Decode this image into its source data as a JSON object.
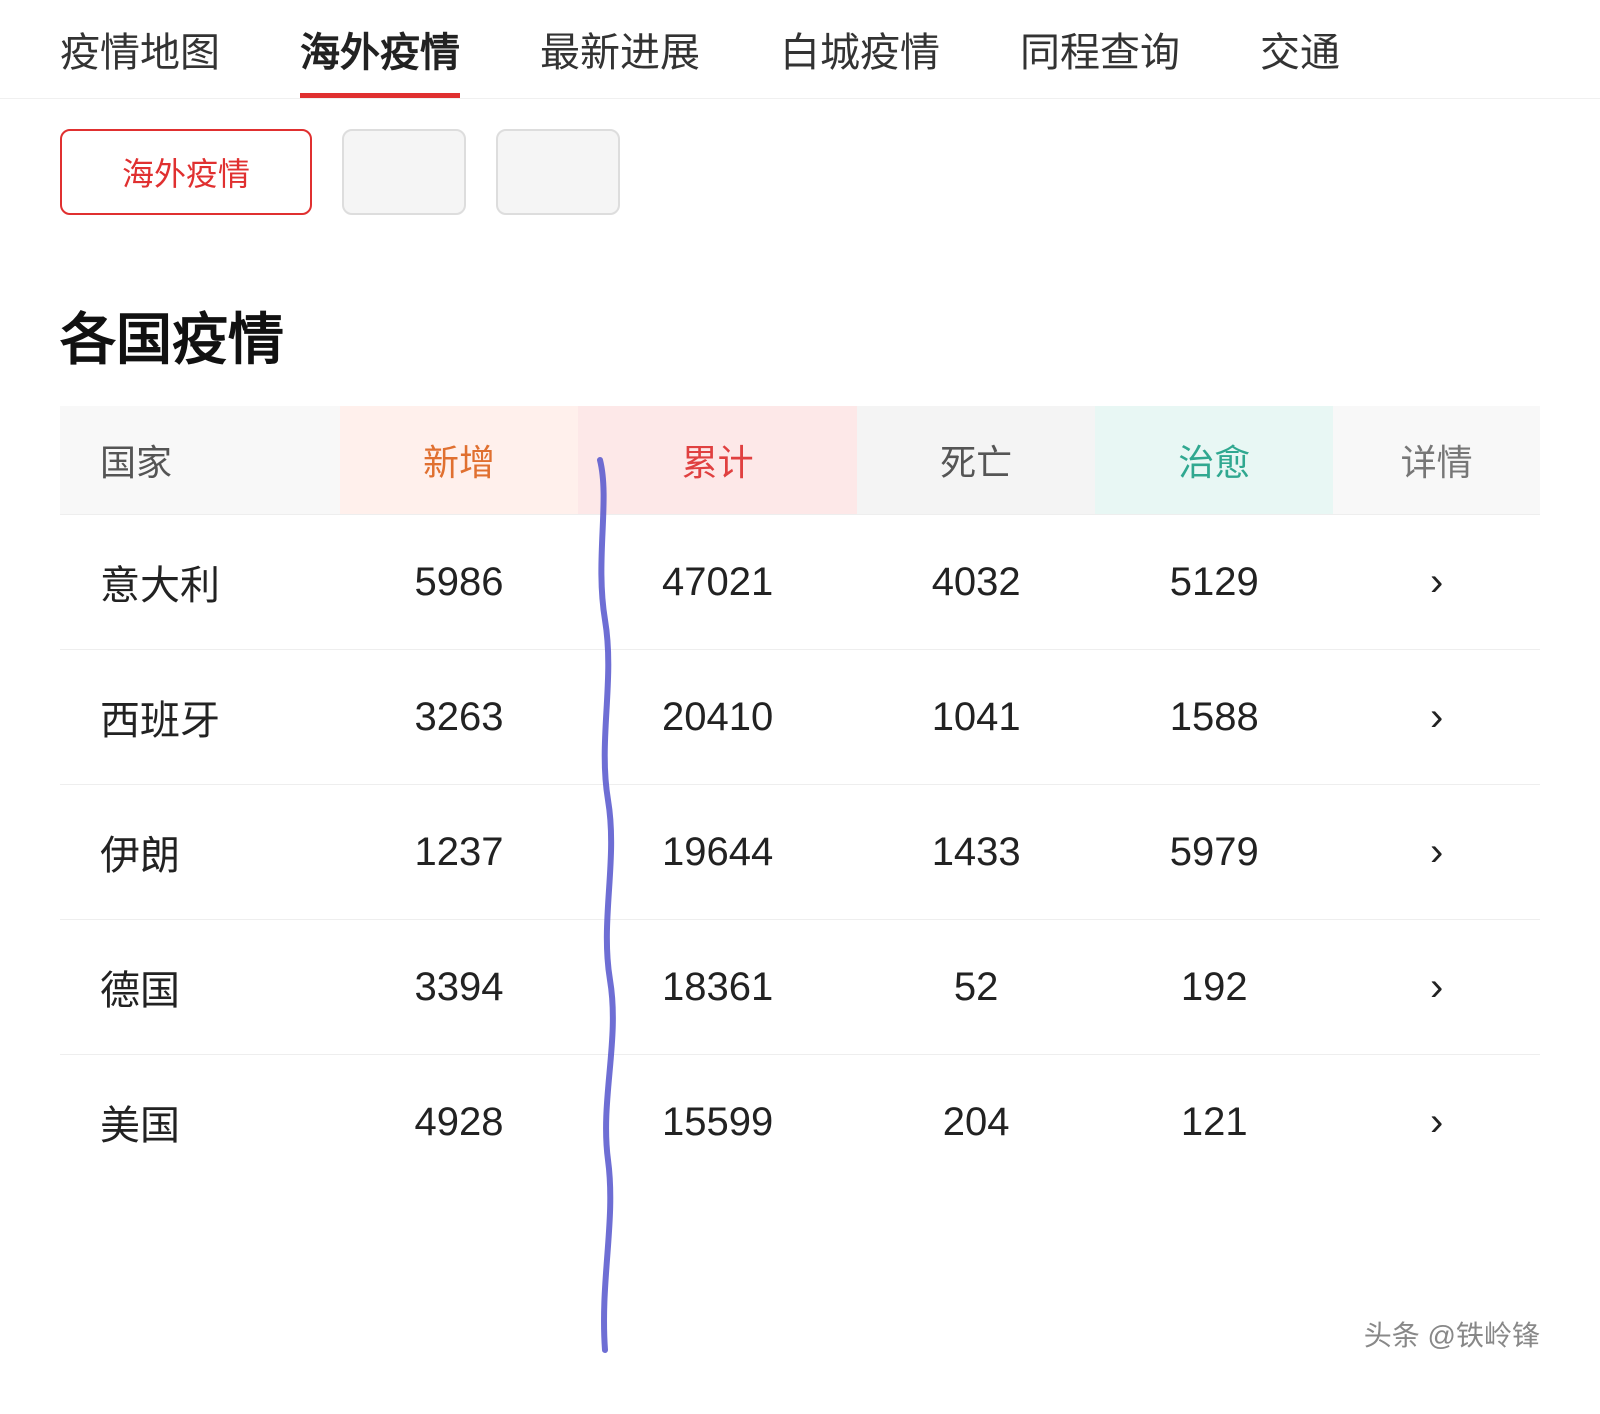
{
  "nav": {
    "items": [
      {
        "label": "疫情地图",
        "active": false
      },
      {
        "label": "海外疫情",
        "active": true
      },
      {
        "label": "最新进展",
        "active": false
      },
      {
        "label": "白城疫情",
        "active": false
      },
      {
        "label": "同程查询",
        "active": false
      },
      {
        "label": "交通",
        "active": false
      }
    ]
  },
  "tabs": [
    {
      "label": "海外疫情",
      "active": true
    },
    {
      "label": "",
      "active": false
    },
    {
      "label": "",
      "active": false
    }
  ],
  "section_title": "各国疫情",
  "table": {
    "headers": {
      "country": "国家",
      "new": "新增",
      "cumulative": "累计",
      "death": "死亡",
      "recovered": "治愈",
      "detail": "详情"
    },
    "rows": [
      {
        "country": "意大利",
        "new": "5986",
        "cumulative": "47021",
        "death": "4032",
        "recovered": "5129"
      },
      {
        "country": "西班牙",
        "new": "3263",
        "cumulative": "20410",
        "death": "1041",
        "recovered": "1588"
      },
      {
        "country": "伊朗",
        "new": "1237",
        "cumulative": "19644",
        "death": "1433",
        "recovered": "5979"
      },
      {
        "country": "德国",
        "new": "3394",
        "cumulative": "18361",
        "death": "52",
        "recovered": "192"
      },
      {
        "country": "美国",
        "new": "4928",
        "cumulative": "15599",
        "death": "204",
        "recovered": "121"
      }
    ]
  },
  "watermark": "头条 @铁岭锋",
  "detail_arrow": "›"
}
